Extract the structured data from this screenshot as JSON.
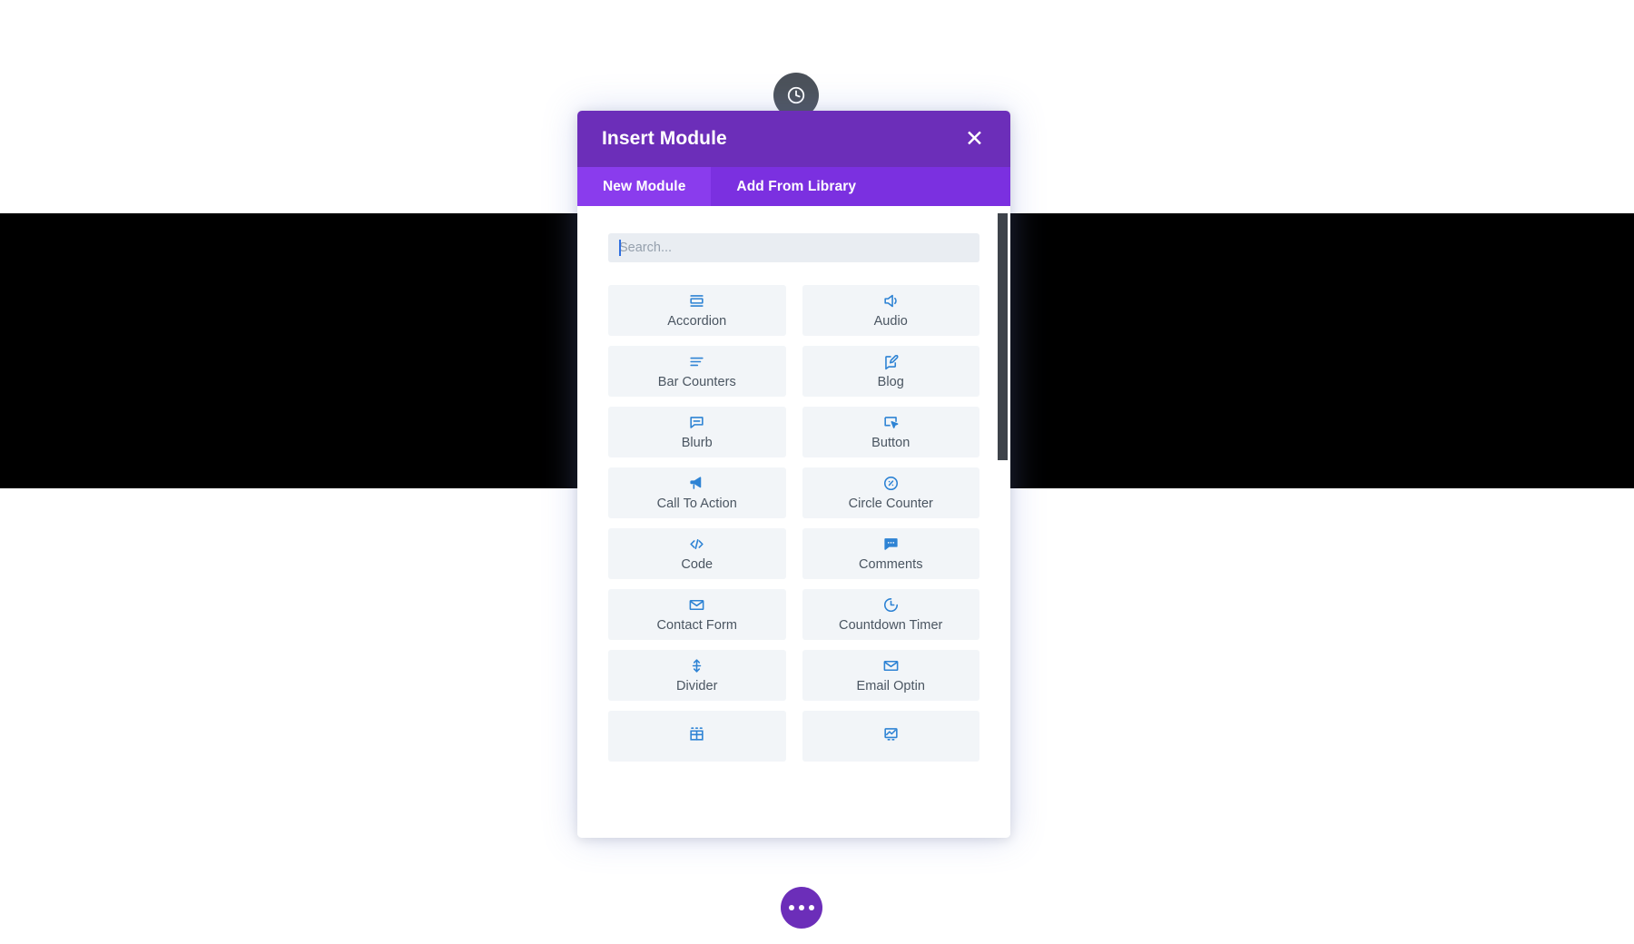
{
  "canvas": {
    "background_color": "#ffffff",
    "band_color": "#000000"
  },
  "history_button": {
    "icon": "clock-history-icon",
    "color": "#4b5159"
  },
  "modal": {
    "title": "Insert Module",
    "close_label": "✕",
    "header_color": "#6c2eb9",
    "tabbar_color": "#7b30e0",
    "active_tab_color": "#8a3ced",
    "tabs": [
      {
        "label": "New Module",
        "active": true
      },
      {
        "label": "Add From Library",
        "active": false
      }
    ],
    "search": {
      "placeholder": "Search...",
      "value": "",
      "caret_visible": true,
      "caret_color": "#2f6fe0"
    },
    "accent_icon_color": "#2e83d4",
    "tile_bg_color": "#f2f5f8",
    "label_color": "#4a5561",
    "modules": [
      {
        "label": "Accordion",
        "icon": "accordion-icon"
      },
      {
        "label": "Audio",
        "icon": "speaker-icon"
      },
      {
        "label": "Bar Counters",
        "icon": "bar-counters-icon"
      },
      {
        "label": "Blog",
        "icon": "blog-pencil-icon"
      },
      {
        "label": "Blurb",
        "icon": "speech-bubble-minus-icon"
      },
      {
        "label": "Button",
        "icon": "cursor-click-icon"
      },
      {
        "label": "Call To Action",
        "icon": "megaphone-icon"
      },
      {
        "label": "Circle Counter",
        "icon": "circle-percent-icon"
      },
      {
        "label": "Code",
        "icon": "code-brackets-icon"
      },
      {
        "label": "Comments",
        "icon": "comment-dots-icon"
      },
      {
        "label": "Contact Form",
        "icon": "envelope-icon"
      },
      {
        "label": "Countdown Timer",
        "icon": "clock-icon"
      },
      {
        "label": "Divider",
        "icon": "vertical-arrows-icon"
      },
      {
        "label": "Email Optin",
        "icon": "envelope-icon"
      },
      {
        "label": "",
        "icon": "grid-table-icon"
      },
      {
        "label": "",
        "icon": "image-chart-icon"
      }
    ],
    "scrollbar": {
      "color": "#3e434a"
    }
  },
  "fab": {
    "icon": "ellipsis-icon",
    "color": "#6c2eb9",
    "dots": 3
  }
}
